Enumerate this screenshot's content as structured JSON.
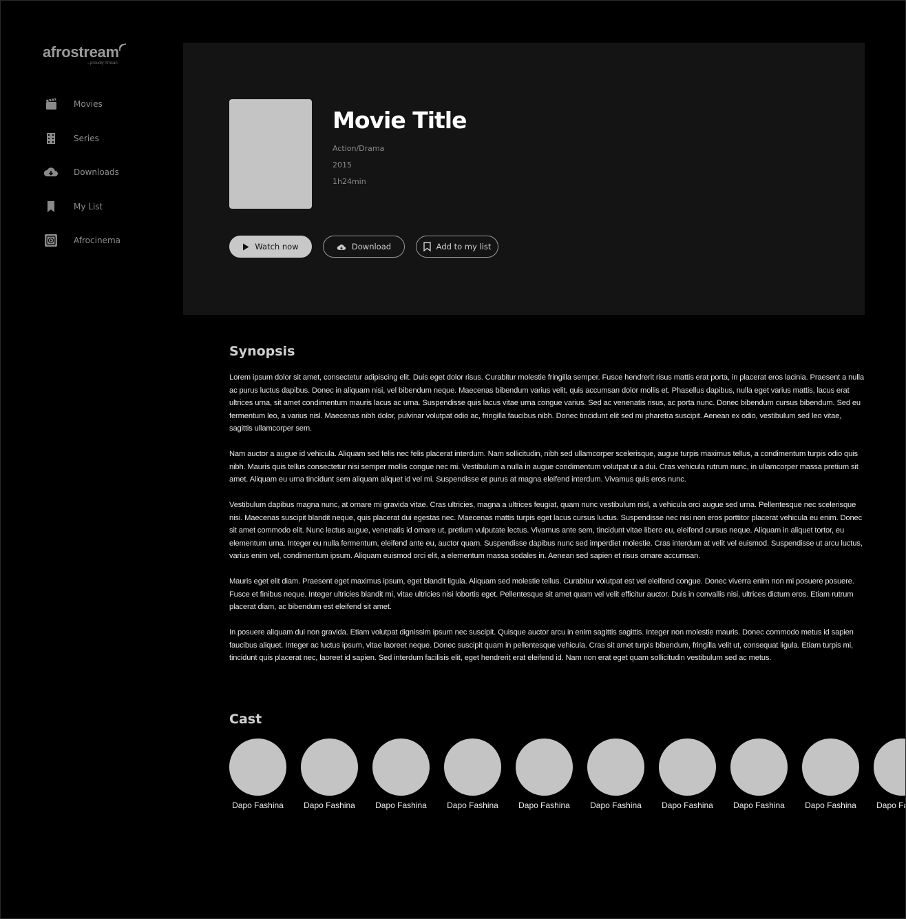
{
  "brand": {
    "name": "afrostream",
    "tagline": "...proudly African"
  },
  "sidebar": {
    "items": [
      {
        "label": "Movies",
        "icon": "clapperboard-icon"
      },
      {
        "label": "Series",
        "icon": "film-strip-icon"
      },
      {
        "label": "Downloads",
        "icon": "cloud-download-icon"
      },
      {
        "label": "My List",
        "icon": "bookmark-icon"
      },
      {
        "label": "Afrocinema",
        "icon": "play-tile-icon"
      }
    ]
  },
  "movie": {
    "title": "Movie Title",
    "genre": "Action/Drama",
    "year": "2015",
    "duration": "1h24min"
  },
  "actions": {
    "watch_label": "Watch now",
    "download_label": "Download",
    "mylist_label": "Add to my list"
  },
  "synopsis": {
    "heading": "Synopsis",
    "paragraphs": [
      "Lorem ipsum dolor sit amet, consectetur adipiscing elit. Duis eget dolor risus. Curabitur molestie fringilla semper. Fusce hendrerit risus mattis erat porta, in placerat eros lacinia. Praesent a nulla ac purus luctus dapibus. Donec in aliquam nisi, vel bibendum neque. Maecenas bibendum varius velit, quis accumsan dolor mollis et. Phasellus dapibus, nulla eget varius mattis, lacus erat ultrices urna, sit amet condimentum mauris lacus ac urna. Suspendisse quis lacus vitae urna congue varius. Sed ac venenatis risus, ac porta nunc. Donec bibendum cursus bibendum. Sed eu fermentum leo, a varius nisl. Maecenas nibh dolor, pulvinar volutpat odio ac, fringilla faucibus nibh. Donec tincidunt elit sed mi pharetra suscipit. Aenean ex odio, vestibulum sed leo vitae, sagittis ullamcorper sem.",
      "Nam auctor a augue id vehicula. Aliquam sed felis nec felis placerat interdum. Nam sollicitudin, nibh sed ullamcorper scelerisque, augue turpis maximus tellus, a condimentum turpis odio quis nibh. Mauris quis tellus consectetur nisi semper mollis congue nec mi. Vestibulum a nulla in augue condimentum volutpat ut a dui. Cras vehicula rutrum nunc, in ullamcorper massa pretium sit amet. Aliquam eu urna tincidunt sem aliquam aliquet id vel mi. Suspendisse et purus at magna eleifend interdum. Vivamus quis eros nunc.",
      "Vestibulum dapibus magna nunc, at ornare mi gravida vitae. Cras ultricies, magna a ultrices feugiat, quam nunc vestibulum nisl, a vehicula orci augue sed urna. Pellentesque nec scelerisque nisi. Maecenas suscipit blandit neque, quis placerat dui egestas nec. Maecenas mattis turpis eget lacus cursus luctus. Suspendisse nec nisi non eros porttitor placerat vehicula eu enim. Donec sit amet commodo elit. Nunc lectus augue, venenatis id ornare ut, pretium vulputate lectus. Vivamus ante sem, tincidunt vitae libero eu, eleifend cursus neque. Aliquam in aliquet tortor, eu elementum urna. Integer eu nulla fermentum, eleifend ante eu, auctor quam. Suspendisse dapibus nunc sed imperdiet molestie. Cras interdum at velit vel euismod. Suspendisse ut arcu luctus, varius enim vel, condimentum ipsum. Aliquam euismod orci elit, a elementum massa sodales in. Aenean sed sapien et risus ornare accumsan.",
      "Mauris eget elit diam. Praesent eget maximus ipsum, eget blandit ligula. Aliquam sed molestie tellus. Curabitur volutpat est vel eleifend congue. Donec viverra enim non mi posuere posuere. Fusce et finibus neque. Integer ultricies blandit mi, vitae ultricies nisi lobortis eget. Pellentesque sit amet quam vel velit efficitur auctor. Duis in convallis nisi, ultrices dictum eros. Etiam rutrum placerat diam, ac bibendum est eleifend sit amet.",
      "In posuere aliquam dui non gravida. Etiam volutpat dignissim ipsum nec suscipit. Quisque auctor arcu in enim sagittis sagittis. Integer non molestie mauris. Donec commodo metus id sapien faucibus aliquet. Integer ac luctus ipsum, vitae laoreet neque. Donec suscipit quam in pellentesque vehicula. Cras sit amet turpis bibendum, fringilla velit ut, consequat ligula. Etiam turpis mi, tincidunt quis placerat nec, laoreet id sapien. Sed interdum facilisis elit, eget hendrerit erat eleifend id. Nam non erat eget quam sollicitudin vestibulum sed ac metus."
    ]
  },
  "cast": {
    "heading": "Cast",
    "members": [
      "Dapo Fashina",
      "Dapo Fashina",
      "Dapo Fashina",
      "Dapo Fashina",
      "Dapo Fashina",
      "Dapo Fashina",
      "Dapo Fashina",
      "Dapo Fashina",
      "Dapo Fashina",
      "Dapo Fashina"
    ]
  },
  "colors": {
    "background": "#000000",
    "hero_panel": "#141414",
    "placeholder": "#c4c4c4",
    "text_muted": "#8f8f8f",
    "text_primary": "#ffffff"
  }
}
